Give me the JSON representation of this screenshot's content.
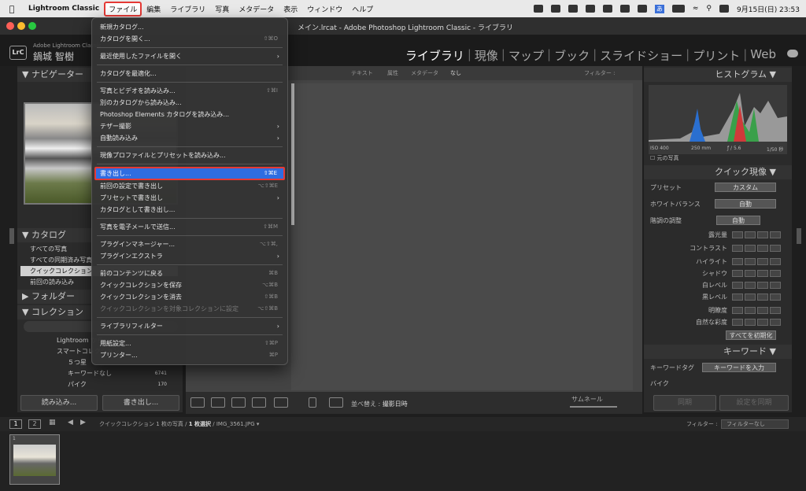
{
  "menubar": {
    "app_name": "Lightroom Classic",
    "items": [
      "ファイル",
      "編集",
      "ライブラリ",
      "写真",
      "メタデータ",
      "表示",
      "ウィンドウ",
      "ヘルプ"
    ],
    "datetime": "9月15日(日)  23:53",
    "input_indicator": "あ"
  },
  "window": {
    "title": "メイン.lrcat - Adobe Photoshop Lightroom Classic - ライブラリ"
  },
  "identity": {
    "logo": "LrC",
    "product": "Adobe Lightroom Classic",
    "user": "鍋城 智樹",
    "modules": [
      "ライブラリ",
      "現像",
      "マップ",
      "ブック",
      "スライドショー",
      "プリント",
      "Web"
    ]
  },
  "file_menu": {
    "items": [
      {
        "label": "新規カタログ...",
        "shortcut": ""
      },
      {
        "label": "カタログを開く...",
        "shortcut": "⇧⌘O"
      },
      {
        "sep": true
      },
      {
        "label": "最近使用したファイルを開く",
        "submenu": true
      },
      {
        "sep": true
      },
      {
        "label": "カタログを最適化...",
        "shortcut": ""
      },
      {
        "sep": true
      },
      {
        "label": "写真とビデオを読み込み...",
        "shortcut": "⇧⌘I"
      },
      {
        "label": "別のカタログから読み込み...",
        "shortcut": ""
      },
      {
        "label": "Photoshop Elements カタログを読み込み...",
        "shortcut": ""
      },
      {
        "label": "テザー撮影",
        "submenu": true
      },
      {
        "label": "自動読み込み",
        "submenu": true
      },
      {
        "sep": true
      },
      {
        "label": "現像プロファイルとプリセットを読み込み...",
        "shortcut": ""
      },
      {
        "sep": true
      },
      {
        "label": "書き出し...",
        "shortcut": "⇧⌘E",
        "highlighted": true
      },
      {
        "label": "前回の設定で書き出し",
        "shortcut": "⌥⇧⌘E"
      },
      {
        "label": "プリセットで書き出し",
        "submenu": true
      },
      {
        "label": "カタログとして書き出し...",
        "shortcut": ""
      },
      {
        "sep": true
      },
      {
        "label": "写真を電子メールで送信...",
        "shortcut": "⇧⌘M"
      },
      {
        "sep": true
      },
      {
        "label": "プラグインマネージャー...",
        "shortcut": "⌥⇧⌘,"
      },
      {
        "label": "プラグインエクストラ",
        "submenu": true
      },
      {
        "sep": true
      },
      {
        "label": "前のコンテンツに戻る",
        "shortcut": "⌘B"
      },
      {
        "label": "クイックコレクションを保存",
        "shortcut": "⌥⌘B"
      },
      {
        "label": "クイックコレクションを消去",
        "shortcut": "⇧⌘B"
      },
      {
        "label": "クイックコレクションを対象コレクションに設定",
        "shortcut": "⌥⇧⌘B",
        "disabled": true
      },
      {
        "sep": true
      },
      {
        "label": "ライブラリフィルター",
        "submenu": true
      },
      {
        "sep": true
      },
      {
        "label": "用紙設定...",
        "shortcut": "⇧⌘P"
      },
      {
        "label": "プリンター...",
        "shortcut": "⌘P"
      }
    ]
  },
  "left_panel": {
    "navigator": "ナビゲーター",
    "catalog": "カタログ",
    "catalog_items": [
      "すべての写真",
      "すべての同期済み写真",
      "クイックコレクション",
      "前回の読み込み"
    ],
    "folders": "フォルダー",
    "collections": "コレクション",
    "collection_items": [
      "Lightroom から",
      "スマートコレクション",
      "５つ星",
      "キーワードなし",
      "パイク"
    ],
    "collection_counts": [
      "",
      "",
      "",
      "6741",
      "170"
    ],
    "import_button": "読み込み...",
    "export_button": "書き出し..."
  },
  "filter_bar": {
    "items": [
      "テキスト",
      "属性",
      "メタデータ",
      "なし"
    ],
    "filter_label": "フィルター :"
  },
  "toolbar": {
    "sort_label": "並べ替え :",
    "sort_value": "撮影日時",
    "thumbnails": "サムネール"
  },
  "right_panel": {
    "histogram": "ヒストグラム",
    "exif": [
      "ISO 400",
      "250 mm",
      "ƒ / 5.6",
      "1/50 秒"
    ],
    "original_photo": "元の写真",
    "quick_develop": "クイック現像",
    "preset_label": "プリセット",
    "preset_value": "カスタム",
    "wb_label": "ホワイトバランス",
    "wb_value": "自動",
    "tone_label": "階調の調整",
    "tone_value": "自動",
    "sliders": [
      "露光量",
      "コントラスト",
      "ハイライト",
      "シャドウ",
      "白レベル",
      "黒レベル",
      "明瞭度",
      "自然な彩度"
    ],
    "reset_all": "すべてを初期化",
    "keywords": "キーワード",
    "keyword_tag_label": "キーワードタグ",
    "keyword_tag_value": "キーワードを入力",
    "keyword_value": "バイク",
    "sync": "同期",
    "sync_settings": "設定を同期"
  },
  "filmstrip": {
    "pages": [
      "1",
      "2"
    ],
    "source": "クイックコレクション",
    "count": "1 枚の写真 /",
    "selected": "1 枚選択",
    "filename": "/ IMG_3561.JPG",
    "filter_label": "フィルター :",
    "filter_value": "フィルターなし",
    "thumb_index": "1"
  }
}
